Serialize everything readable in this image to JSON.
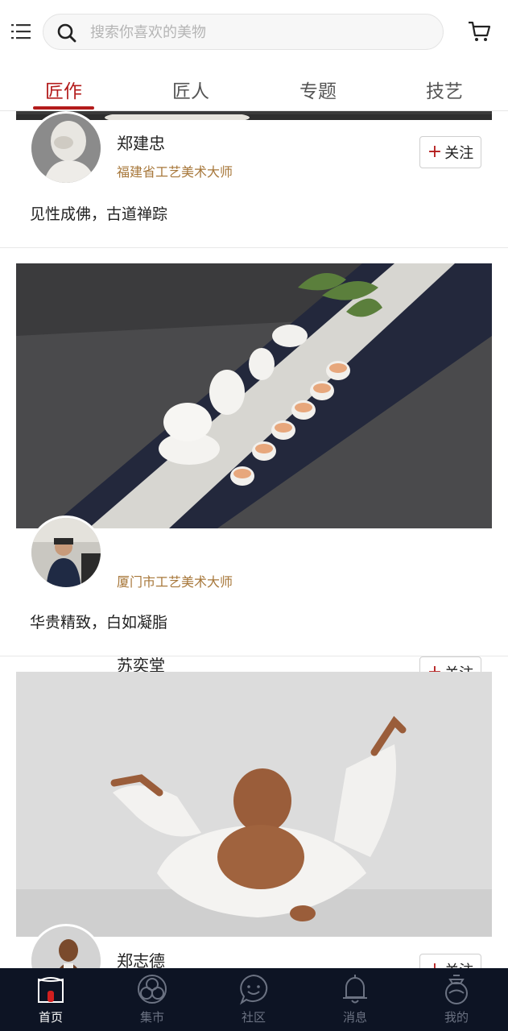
{
  "header": {
    "menu_icon": "menu-icon",
    "search_placeholder": "搜索你喜欢的美物",
    "cart_icon": "cart-icon"
  },
  "tabs": [
    {
      "label": "匠作",
      "active": true
    },
    {
      "label": "匠人",
      "active": false
    },
    {
      "label": "专题",
      "active": false
    },
    {
      "label": "技艺",
      "active": false
    }
  ],
  "feed": [
    {
      "name": "郑建忠",
      "title": "福建省工艺美术大师",
      "follow_label": "关注",
      "desc": "见性成佛，古道禅踪"
    },
    {
      "name": "苏奕堂",
      "title": "厦门市工艺美术大师",
      "follow_label": "关注",
      "desc": "华贵精致，白如凝脂"
    },
    {
      "name": "郑志德",
      "title": "",
      "follow_label": "关注",
      "desc": ""
    }
  ],
  "bottom_nav": [
    {
      "label": "首页",
      "icon": "home-icon",
      "active": true
    },
    {
      "label": "集市",
      "icon": "market-icon",
      "active": false
    },
    {
      "label": "社区",
      "icon": "community-icon",
      "active": false
    },
    {
      "label": "消息",
      "icon": "bell-icon",
      "active": false
    },
    {
      "label": "我的",
      "icon": "profile-icon",
      "active": false
    }
  ],
  "colors": {
    "accent": "#b31b1b",
    "title_gold": "#a7773a",
    "nav_bg": "#0d1424"
  }
}
